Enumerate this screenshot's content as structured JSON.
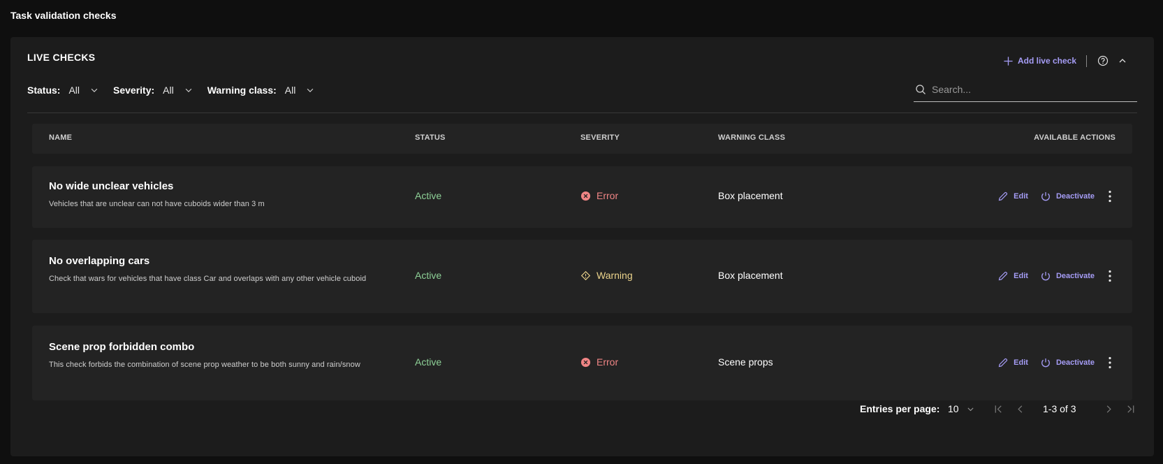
{
  "page": {
    "title": "Task validation checks"
  },
  "section": {
    "title": "LIVE CHECKS",
    "add_label": "Add live check"
  },
  "filters": [
    {
      "label": "Status:",
      "value": "All"
    },
    {
      "label": "Severity:",
      "value": "All"
    },
    {
      "label": "Warning class:",
      "value": "All"
    }
  ],
  "search": {
    "placeholder": "Search...",
    "value": ""
  },
  "table": {
    "columns": [
      "NAME",
      "STATUS",
      "SEVERITY",
      "WARNING CLASS",
      "AVAILABLE ACTIONS"
    ],
    "rows": [
      {
        "name": "No wide unclear vehicles",
        "description": "Vehicles that are unclear can not have cuboids wider than 3 m",
        "status": "Active",
        "severity": "Error",
        "warning_class": "Box placement",
        "edit_label": "Edit",
        "deactivate_label": "Deactivate"
      },
      {
        "name": "No overlapping cars",
        "description": "Check that wars for vehicles that have class Car and overlaps with any other vehicle cuboid",
        "status": "Active",
        "severity": "Warning",
        "warning_class": "Box placement",
        "edit_label": "Edit",
        "deactivate_label": "Deactivate"
      },
      {
        "name": "Scene prop forbidden combo",
        "description": "This check forbids the combination of scene prop weather to be both sunny and rain/snow",
        "status": "Active",
        "severity": "Error",
        "warning_class": "Scene props",
        "edit_label": "Edit",
        "deactivate_label": "Deactivate"
      }
    ]
  },
  "pagination": {
    "entries_label": "Entries per page:",
    "page_size": "10",
    "range": "1-3 of 3"
  },
  "colors": {
    "accent": "#a59cf5",
    "active": "#8ed197",
    "error": "#f08585",
    "warning": "#ecd48c"
  },
  "icons": {
    "add": "plus-icon",
    "help": "help-circle-icon",
    "collapse": "chevron-up-icon",
    "dropdown": "chevron-down-icon",
    "search": "search-icon",
    "edit": "pencil-icon",
    "deactivate": "power-icon",
    "more": "more-vertical-icon",
    "error": "error-circle-icon",
    "warning": "warning-diamond-icon",
    "first": "first-page-icon",
    "prev": "chevron-left-icon",
    "next": "chevron-right-icon",
    "last": "last-page-icon"
  }
}
